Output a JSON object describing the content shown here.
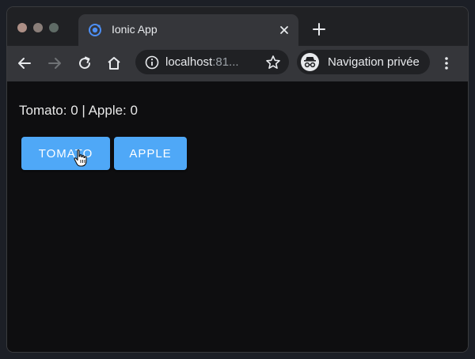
{
  "browser": {
    "tab": {
      "title": "Ionic App",
      "favicon": "ionic-icon"
    },
    "address": {
      "host": "localhost",
      "port_truncated": ":81..."
    },
    "profile": {
      "label": "Navigation privée",
      "icon": "incognito-icon"
    }
  },
  "page": {
    "counts": "Tomato: 0 | Apple: 0",
    "buttons": {
      "tomato": "TOMATO",
      "apple": "APPLE"
    }
  },
  "colors": {
    "accent": "#4fa8f7",
    "page_background": "#0e0e10",
    "chrome_dark": "#202124",
    "chrome_toolbar": "#35363a"
  }
}
